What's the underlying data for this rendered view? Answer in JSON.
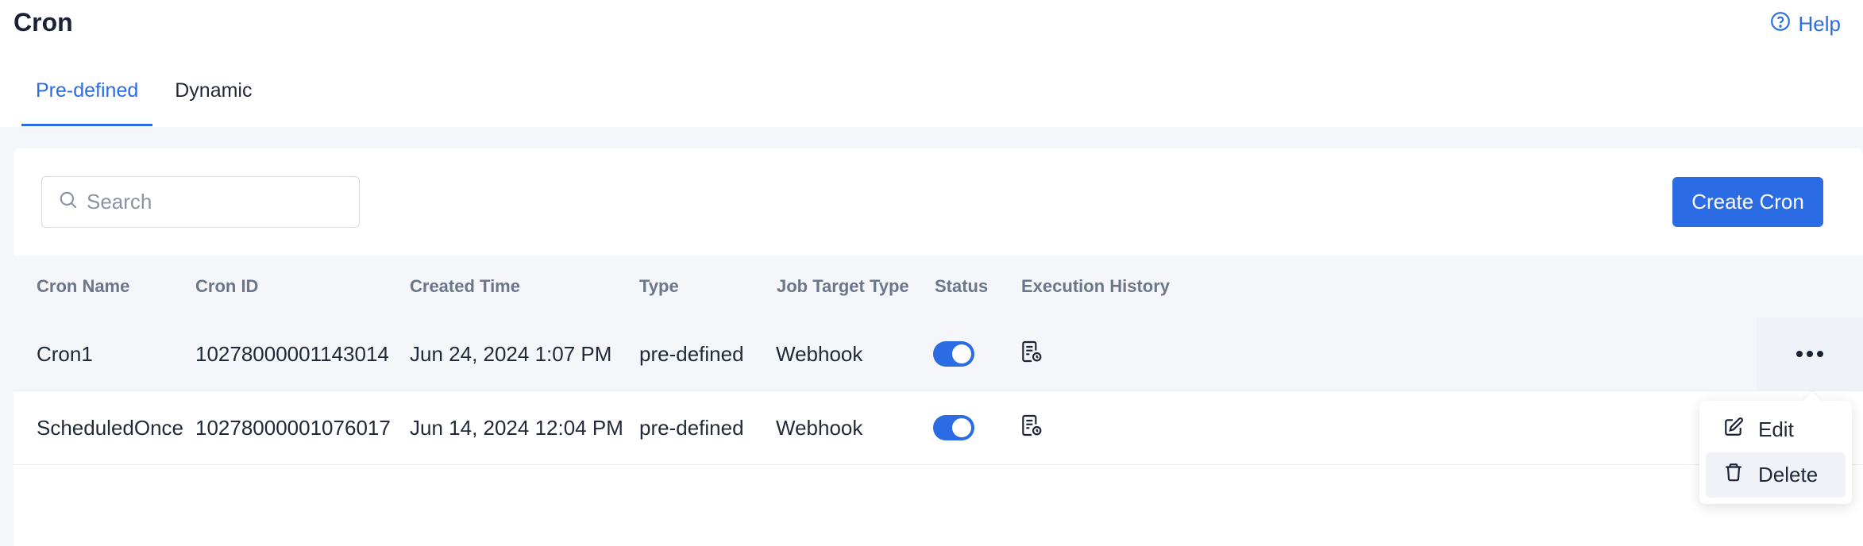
{
  "page": {
    "title": "Cron",
    "help_label": "Help"
  },
  "tabs": [
    {
      "label": "Pre-defined",
      "active": true
    },
    {
      "label": "Dynamic",
      "active": false
    }
  ],
  "toolbar": {
    "search_placeholder": "Search",
    "create_label": "Create Cron"
  },
  "table": {
    "columns": [
      "Cron Name",
      "Cron ID",
      "Created Time",
      "Type",
      "Job Target Type",
      "Status",
      "Execution History"
    ],
    "rows": [
      {
        "name": "Cron1",
        "id": "10278000001143014",
        "created": "Jun 24, 2024 1:07 PM",
        "type": "pre-defined",
        "target": "Webhook",
        "status_on": true
      },
      {
        "name": "ScheduledOnce",
        "id": "10278000001076017",
        "created": "Jun 14, 2024 12:04 PM",
        "type": "pre-defined",
        "target": "Webhook",
        "status_on": true
      }
    ]
  },
  "menu": {
    "edit_label": "Edit",
    "delete_label": "Delete"
  },
  "colors": {
    "accent": "#2b6be3",
    "background": "#f5f6fa"
  },
  "icons": [
    "help-circle-icon",
    "search-icon",
    "execution-history-icon",
    "more-horizontal-icon",
    "edit-icon",
    "trash-icon"
  ]
}
